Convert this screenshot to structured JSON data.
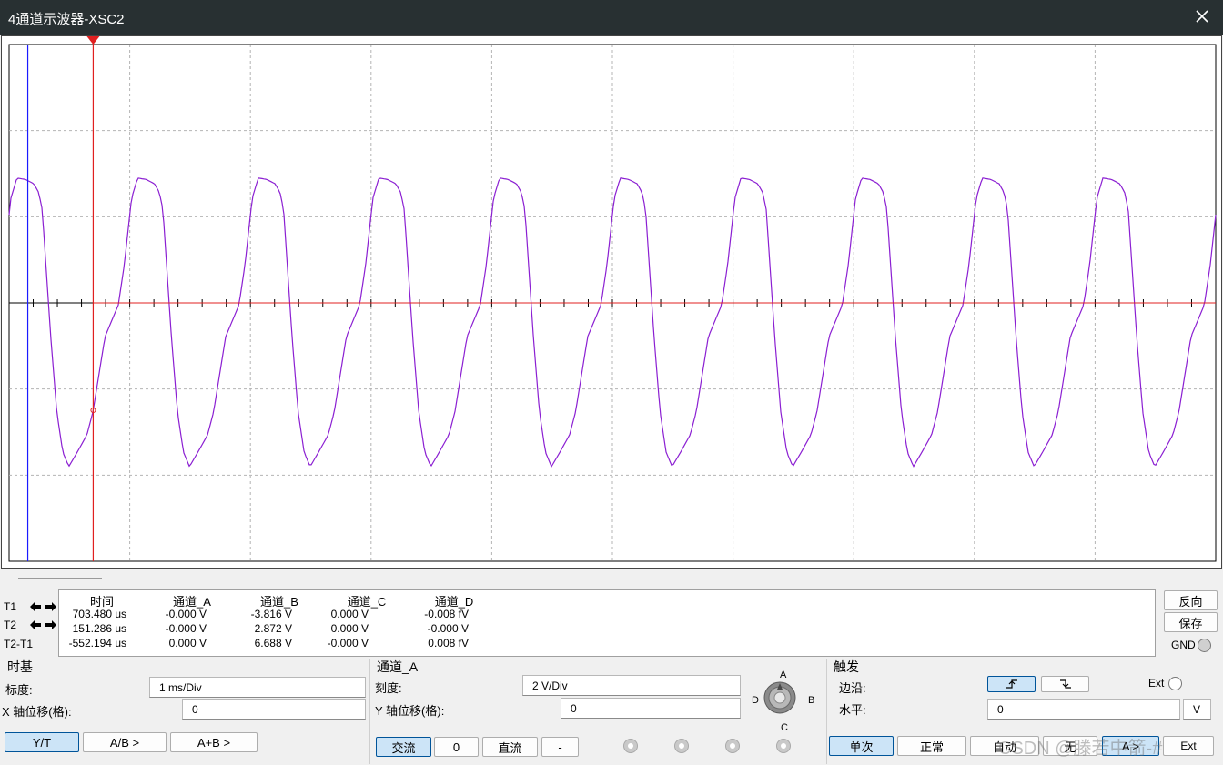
{
  "window": {
    "title": "4通道示波器-XSC2"
  },
  "colors": {
    "trace": "#8b1fd2",
    "cursor1": "#1a1aff",
    "cursor2": "#e02020",
    "axis": "#000000",
    "grid": "#b4b4b4",
    "titlebar": "#283032"
  },
  "icons": {
    "close": "close-icon",
    "left": "arrow-left-icon",
    "right": "arrow-right-icon",
    "knob": "channel-selector-knob-icon",
    "trigger_marker": "trigger-marker-icon"
  },
  "cursors": {
    "t1_label": "T1",
    "t2_label": "T2",
    "diff_label": "T2-T1",
    "t1_position_fraction": 0.0155,
    "t2_position_fraction": 0.0697
  },
  "readout": {
    "headers": [
      "时间",
      "通道_A",
      "通道_B",
      "通道_C",
      "通道_D"
    ],
    "rows": [
      [
        "703.480 us",
        "-0.000 V",
        "-3.816 V",
        "0.000 V",
        "-0.008 fV"
      ],
      [
        "151.286 us",
        "-0.000 V",
        "2.872 V",
        "0.000 V",
        "-0.000 V"
      ],
      [
        "-552.194 us",
        "0.000 V",
        "6.688 V",
        "-0.000 V",
        "0.008 fV"
      ]
    ]
  },
  "side_buttons": {
    "reverse": "反向",
    "save": "保存",
    "gnd": "GND"
  },
  "timebase": {
    "title": "时基",
    "scale_label": "标度:",
    "scale_value": "1 ms/Div",
    "xpos_label": "X 轴位移(格):",
    "xpos_value": "0",
    "modes": [
      "Y/T",
      "A/B >",
      "A+B >"
    ],
    "active_mode": "Y/T"
  },
  "channel": {
    "title": "通道_A",
    "scale_label": "刻度:",
    "scale_value": "2  V/Div",
    "ypos_label": "Y 轴位移(格):",
    "ypos_value": "0",
    "coupling": [
      "交流",
      "0",
      "直流",
      "-"
    ],
    "active_coupling": "交流",
    "knob_labels": {
      "a": "A",
      "b": "B",
      "c": "C",
      "d": "D"
    }
  },
  "trigger": {
    "title": "触发",
    "edge_label": "边沿:",
    "level_label": "水平:",
    "level_value": "0",
    "level_unit": "V",
    "ext_label": "Ext",
    "modes": [
      "单次",
      "正常",
      "自动",
      "无"
    ],
    "active_mode": "单次",
    "source_buttons": [
      "A >",
      "Ext"
    ]
  },
  "watermark": "CSDN @滕若中箭-#",
  "chart_data": {
    "type": "line",
    "x_divisions": 10,
    "y_divisions": 6,
    "time_per_div_ms": 1,
    "volts_per_div": 2,
    "series": [
      {
        "name": "通道_B",
        "period_divisions": 1.0,
        "x_start_div": 0,
        "y_start_v": 2.0,
        "peak_v": 2.9,
        "trough_v": -3.8
      }
    ]
  }
}
